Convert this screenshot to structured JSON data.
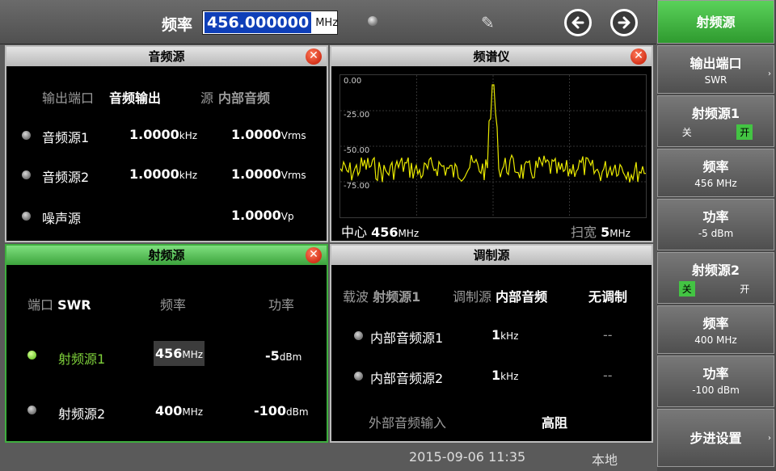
{
  "top": {
    "freq_label": "频率",
    "freq_value": "456.000000",
    "freq_unit": "MHz"
  },
  "audio_panel": {
    "title": "音频源",
    "output_port_label": "输出端口",
    "output_port_value": "音频输出",
    "source_label": "源",
    "source_value": "内部音频",
    "rows": [
      {
        "name": "音频源1",
        "freq": "1.0000",
        "freq_unit": "kHz",
        "amp": "1.0000",
        "amp_unit": "Vrms"
      },
      {
        "name": "音频源2",
        "freq": "1.0000",
        "freq_unit": "kHz",
        "amp": "1.0000",
        "amp_unit": "Vrms"
      },
      {
        "name": "噪声源",
        "freq": "",
        "freq_unit": "",
        "amp": "1.0000",
        "amp_unit": "Vp"
      }
    ]
  },
  "spectrum_panel": {
    "title": "频谱仪",
    "levels": [
      "0.00",
      "-25.00",
      "-50.00",
      "-75.00"
    ],
    "center_label": "中心",
    "center_value": "456",
    "center_unit": "MHz",
    "span_label": "扫宽",
    "span_value": "5",
    "span_unit": "MHz",
    "trace_color": "#e8e800"
  },
  "rf_panel": {
    "title": "射频源",
    "port_label": "端口",
    "port_value": "SWR",
    "col_freq": "频率",
    "col_power": "功率",
    "rows": [
      {
        "name": "射频源1",
        "freq": "456",
        "freq_unit": "MHz",
        "power": "-5",
        "power_unit": "dBm",
        "active": true
      },
      {
        "name": "射频源2",
        "freq": "400",
        "freq_unit": "MHz",
        "power": "-100",
        "power_unit": "dBm",
        "active": false
      }
    ]
  },
  "mod_panel": {
    "title": "调制源",
    "carrier_label": "载波",
    "carrier_value": "射频源1",
    "mod_label": "调制源",
    "mod_value": "内部音频",
    "mod_state": "无调制",
    "rows": [
      {
        "name": "内部音频源1",
        "freq": "1",
        "freq_unit": "kHz",
        "extra": "--"
      },
      {
        "name": "内部音频源2",
        "freq": "1",
        "freq_unit": "kHz",
        "extra": "--"
      }
    ],
    "ext_label": "外部音频输入",
    "ext_value": "高阻"
  },
  "status": {
    "datetime": "2015-09-06 11:35",
    "mode": "本地"
  },
  "side_menu": {
    "title": "射频源",
    "items": [
      {
        "l1": "输出端口",
        "l2": "SWR"
      },
      {
        "l1": "射频源1",
        "off": "关",
        "on": "开",
        "state": "on"
      },
      {
        "l1": "频率",
        "l2": "456 MHz"
      },
      {
        "l1": "功率",
        "l2": "-5 dBm"
      },
      {
        "l1": "射频源2",
        "off": "关",
        "on": "开",
        "state": "off"
      },
      {
        "l1": "频率",
        "l2": "400 MHz"
      },
      {
        "l1": "功率",
        "l2": "-100 dBm"
      },
      {
        "l1": "步进设置"
      }
    ]
  },
  "colors": {
    "active_green": "#3fae3f",
    "highlight_blue": "#0f3fb8",
    "close_red": "#d4321a"
  }
}
